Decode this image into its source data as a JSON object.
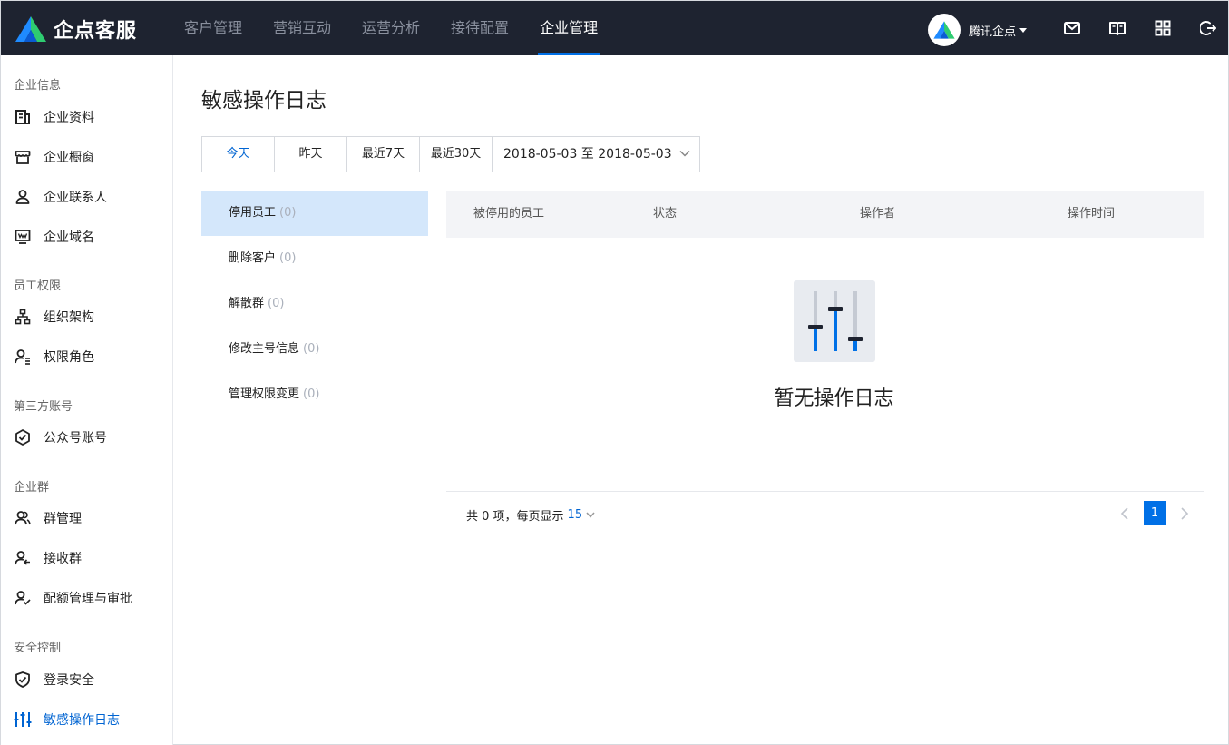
{
  "header": {
    "brand": "企点客服",
    "nav": [
      "客户管理",
      "营销互动",
      "运营分析",
      "接待配置",
      "企业管理"
    ],
    "active_nav": "企业管理",
    "user_name": "腾讯企点",
    "accent": "#0070e6",
    "bg": "#1e2330",
    "icons": [
      "mail-icon",
      "book-icon",
      "apps-grid-icon",
      "logout-icon"
    ]
  },
  "sidebar": {
    "groups": [
      {
        "title": "企业信息",
        "items": [
          "企业资料",
          "企业橱窗",
          "企业联系人",
          "企业域名"
        ]
      },
      {
        "title": "员工权限",
        "items": [
          "组织架构",
          "权限角色"
        ]
      },
      {
        "title": "第三方账号",
        "items": [
          "公众号账号"
        ]
      },
      {
        "title": "企业群",
        "items": [
          "群管理",
          "接收群",
          "配额管理与审批"
        ]
      },
      {
        "title": "安全控制",
        "items": [
          "登录安全",
          "敏感操作日志"
        ]
      }
    ],
    "active_item": "敏感操作日志"
  },
  "main": {
    "title": "敏感操作日志",
    "date_filters": [
      "今天",
      "昨天",
      "最近7天",
      "最近30天"
    ],
    "active_filter": "今天",
    "date_range": "2018-05-03 至 2018-05-03",
    "categories": [
      {
        "label": "停用员工",
        "count": "(0)"
      },
      {
        "label": "删除客户",
        "count": "(0)"
      },
      {
        "label": "解散群",
        "count": "(0)"
      },
      {
        "label": "修改主号信息",
        "count": "(0)"
      },
      {
        "label": "管理权限变更",
        "count": "(0)"
      }
    ],
    "active_category": "停用员工",
    "table_headers": [
      "被停用的员工",
      "状态",
      "操作者",
      "操作时间"
    ],
    "empty_text": "暂无操作日志",
    "pagination": {
      "summary": "共 0 项，每页显示",
      "page_size": "15",
      "current_page": "1"
    }
  }
}
